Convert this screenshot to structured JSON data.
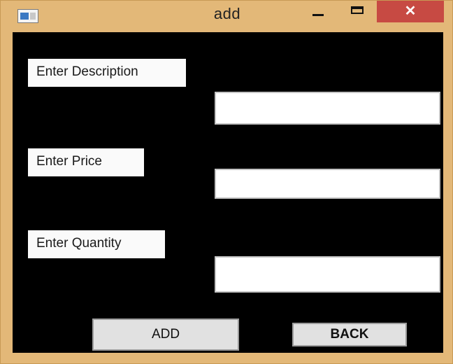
{
  "window": {
    "title": "add",
    "close_glyph": "✕"
  },
  "form": {
    "description_label": "Enter Description",
    "price_label": "Enter Price",
    "quantity_label": "Enter Quantity",
    "description_value": "",
    "price_value": "",
    "quantity_value": ""
  },
  "buttons": {
    "add_label": "ADD",
    "back_label": "BACK"
  },
  "icons": {
    "app": "app-window-icon",
    "minimize": "minimize-icon",
    "maximize": "maximize-icon",
    "close": "close-icon"
  },
  "colors": {
    "frame": "#e3b878",
    "client_background": "#000000",
    "close_button": "#c74a43"
  }
}
